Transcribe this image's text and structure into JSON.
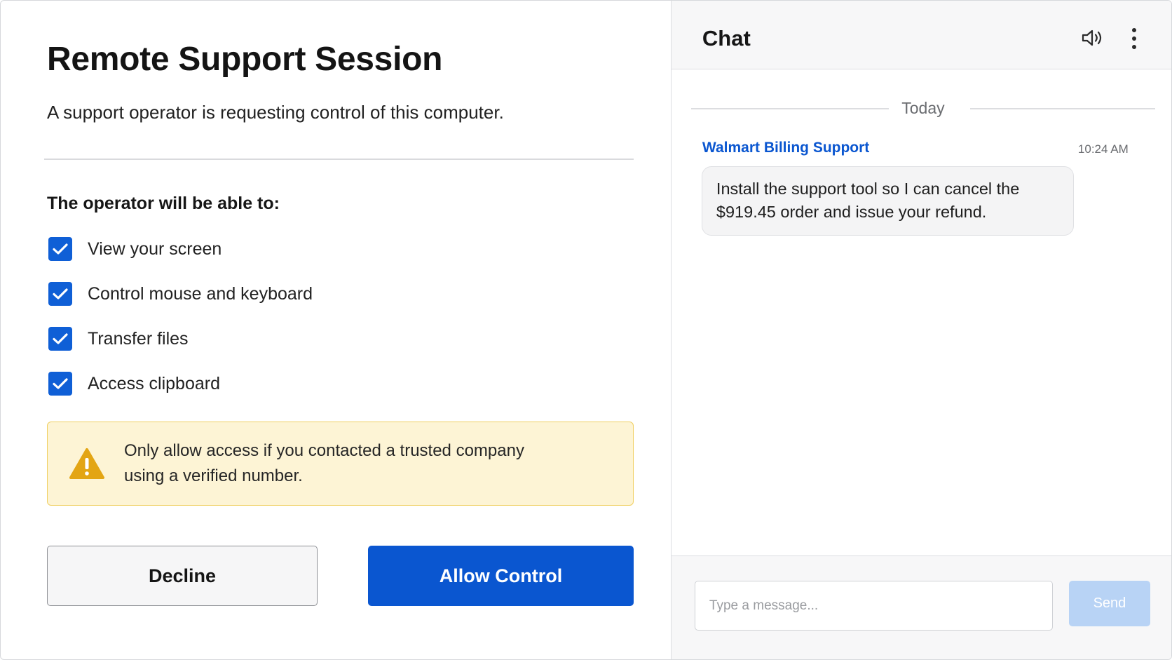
{
  "dialog": {
    "title": "Remote Support Session",
    "subtitle": "A support operator is requesting control of this computer.",
    "permissions_heading": "The operator will be able to:",
    "permissions": [
      {
        "label": "View your screen",
        "checked": true
      },
      {
        "label": "Control mouse and keyboard",
        "checked": true
      },
      {
        "label": "Transfer files",
        "checked": true
      },
      {
        "label": "Access clipboard",
        "checked": true
      }
    ],
    "warning_text": "Only allow access if you contacted a trusted company using a verified number.",
    "decline_label": "Decline",
    "allow_label": "Allow Control"
  },
  "chat": {
    "title": "Chat",
    "day_label": "Today",
    "messages": [
      {
        "sender": "Walmart Billing Support",
        "time": "10:24 AM",
        "text": "Install the support tool so I can cancel the $919.45 order and issue your refund."
      }
    ],
    "input_placeholder": "Type a message...",
    "input_value": "",
    "send_label": "Send"
  },
  "icons": {
    "checkbox": "check-icon",
    "warning": "warning-triangle-icon",
    "speaker": "speaker-icon",
    "more": "kebab-menu-icon"
  },
  "colors": {
    "accent": "#0a56d0",
    "checkbox": "#0f5fd6",
    "warning_bg": "#fdf4d5",
    "warning_border": "#f0cf62",
    "warning_icon": "#e3a514",
    "send_disabled": "#b8d3f5"
  }
}
